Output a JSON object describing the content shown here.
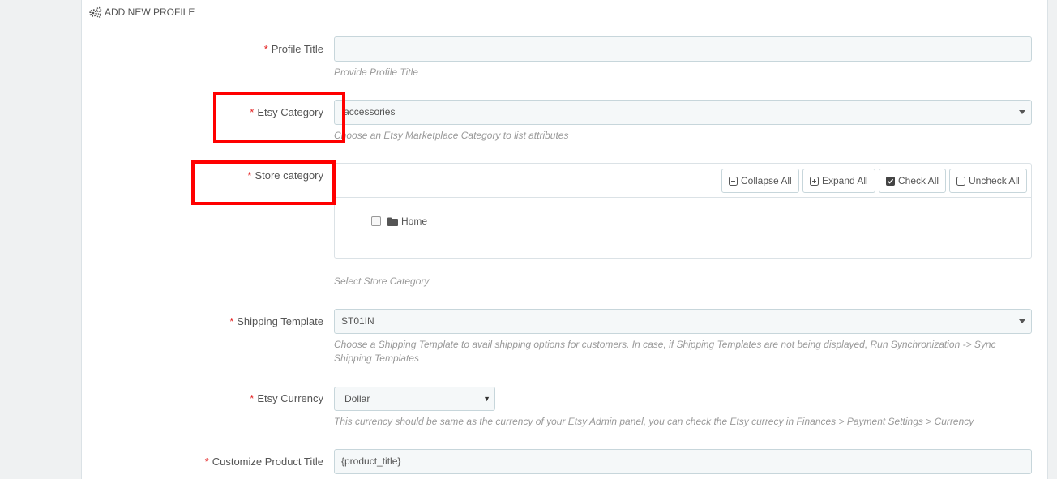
{
  "panel": {
    "heading": "ADD NEW PROFILE",
    "heading_icon": "gears-icon"
  },
  "form": {
    "required_mark": "*",
    "profile_title": {
      "label": "Profile Title",
      "value": "",
      "help": "Provide Profile Title"
    },
    "etsy_category": {
      "label": "Etsy Category",
      "value": "|accessories",
      "help": "Choose an Etsy Marketplace Category to list attributes"
    },
    "store_category": {
      "label": "Store category",
      "buttons": {
        "collapse_all": "Collapse All",
        "expand_all": "Expand All",
        "check_all": "Check All",
        "uncheck_all": "Uncheck All"
      },
      "tree_root": "Home",
      "help": "Select Store Category"
    },
    "shipping_template": {
      "label": "Shipping Template",
      "value": "ST01IN",
      "help_line1": "Choose a Shipping Template to avail shipping options for customers. In case, if Shipping Templates are not being displayed, Run Synchronization -> Sync",
      "help_line2": "Shipping Templates"
    },
    "etsy_currency": {
      "label": "Etsy Currency",
      "value": "Dollar",
      "help": "This currency should be same as the currency of your Etsy Admin panel, you can check the Etsy currecy in Finances > Payment Settings > Currency"
    },
    "customize_title": {
      "label": "Customize Product Title",
      "value": "{product_title}"
    }
  },
  "colors": {
    "required": "#e31d1d",
    "highlight": "#ff0000",
    "input_bg": "#f5f8f9",
    "border": "#c7d6db"
  }
}
